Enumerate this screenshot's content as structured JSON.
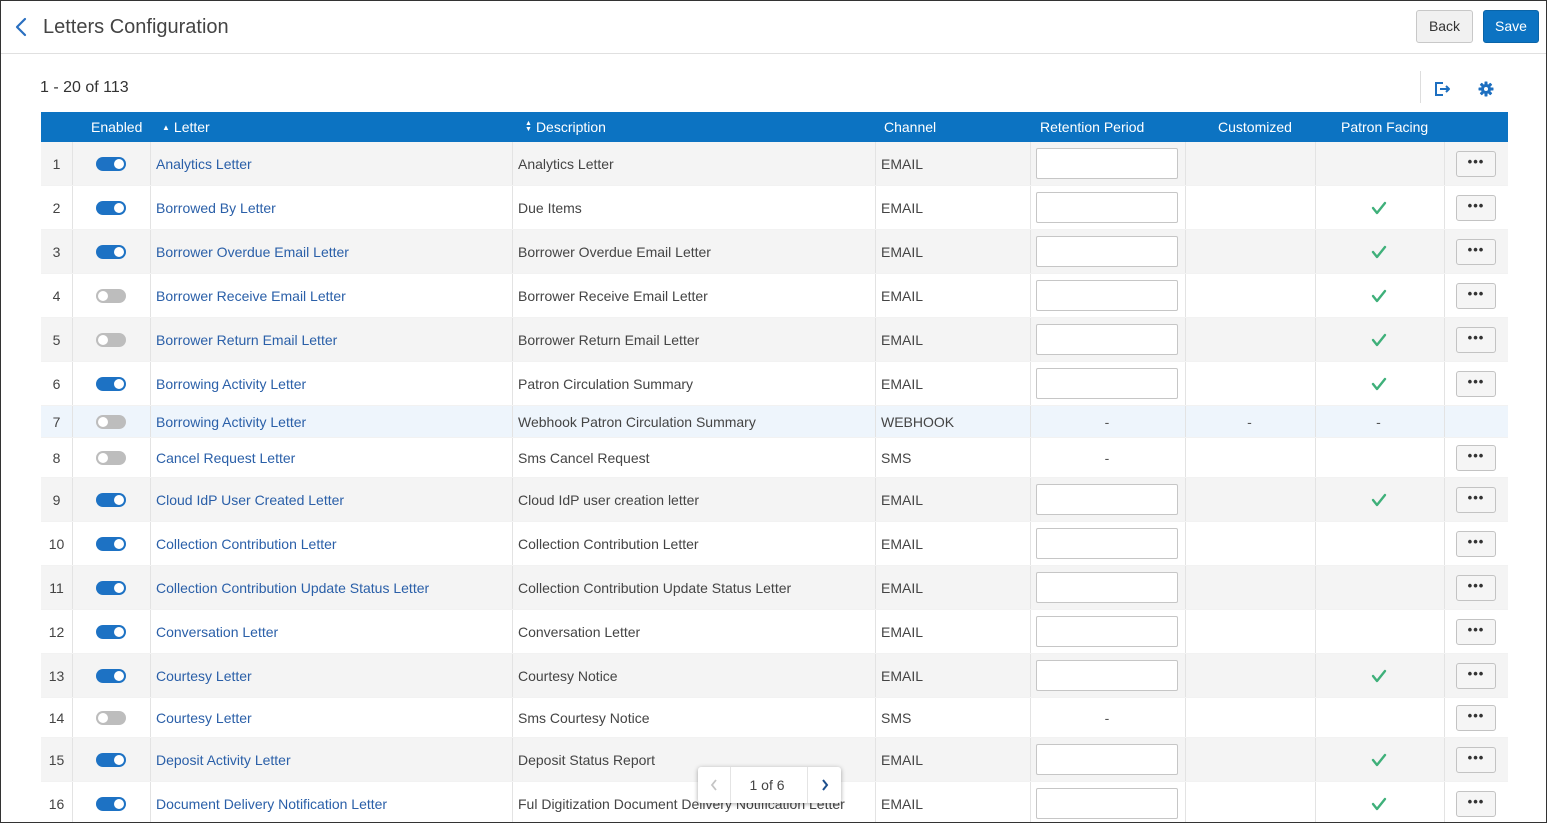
{
  "header": {
    "title": "Letters Configuration",
    "back_label": "Back",
    "save_label": "Save"
  },
  "count_label": "1 - 20 of 113",
  "toolbar": {
    "export_icon": "export-icon",
    "settings_icon": "gear-icon"
  },
  "columns": {
    "enabled": "Enabled",
    "letter": "Letter",
    "description": "Description",
    "channel": "Channel",
    "retention": "Retention Period",
    "customized": "Customized",
    "patron_facing": "Patron Facing"
  },
  "sort": {
    "letter": "ascending",
    "description": "unsorted"
  },
  "rows": [
    {
      "num": "1",
      "enabled": true,
      "letter": "Analytics Letter",
      "description": "Analytics Letter",
      "channel": "EMAIL",
      "retention": "input",
      "customized": "",
      "patron": false,
      "more": true
    },
    {
      "num": "2",
      "enabled": true,
      "letter": "Borrowed By Letter",
      "description": "Due Items",
      "channel": "EMAIL",
      "retention": "input",
      "customized": "",
      "patron": true,
      "more": true
    },
    {
      "num": "3",
      "enabled": true,
      "letter": "Borrower Overdue Email Letter",
      "description": "Borrower Overdue Email Letter",
      "channel": "EMAIL",
      "retention": "input",
      "customized": "",
      "patron": true,
      "more": true
    },
    {
      "num": "4",
      "enabled": false,
      "letter": "Borrower Receive Email Letter",
      "description": "Borrower Receive Email Letter",
      "channel": "EMAIL",
      "retention": "input",
      "customized": "",
      "patron": true,
      "more": true
    },
    {
      "num": "5",
      "enabled": false,
      "letter": "Borrower Return Email Letter",
      "description": "Borrower Return Email Letter",
      "channel": "EMAIL",
      "retention": "input",
      "customized": "",
      "patron": true,
      "more": true
    },
    {
      "num": "6",
      "enabled": true,
      "letter": "Borrowing Activity Letter",
      "description": "Patron Circulation Summary",
      "channel": "EMAIL",
      "retention": "input",
      "customized": "",
      "patron": true,
      "more": true
    },
    {
      "num": "7",
      "enabled": false,
      "letter": "Borrowing Activity Letter",
      "description": "Webhook Patron Circulation Summary",
      "channel": "WEBHOOK",
      "retention": "-",
      "customized": "-",
      "patron": "-",
      "more": false,
      "highlight": true
    },
    {
      "num": "8",
      "enabled": false,
      "letter": "Cancel Request Letter",
      "description": "Sms Cancel Request",
      "channel": "SMS",
      "retention": "-",
      "customized": "",
      "patron": false,
      "more": true
    },
    {
      "num": "9",
      "enabled": true,
      "letter": "Cloud IdP User Created Letter",
      "description": "Cloud IdP user creation letter",
      "channel": "EMAIL",
      "retention": "input",
      "customized": "",
      "patron": true,
      "more": true
    },
    {
      "num": "10",
      "enabled": true,
      "letter": "Collection Contribution Letter",
      "description": "Collection Contribution Letter",
      "channel": "EMAIL",
      "retention": "input",
      "customized": "",
      "patron": false,
      "more": true
    },
    {
      "num": "11",
      "enabled": true,
      "letter": "Collection Contribution Update Status Letter",
      "description": "Collection Contribution Update Status Letter",
      "channel": "EMAIL",
      "retention": "input",
      "customized": "",
      "patron": false,
      "more": true
    },
    {
      "num": "12",
      "enabled": true,
      "letter": "Conversation Letter",
      "description": "Conversation Letter",
      "channel": "EMAIL",
      "retention": "input",
      "customized": "",
      "patron": false,
      "more": true
    },
    {
      "num": "13",
      "enabled": true,
      "letter": "Courtesy Letter",
      "description": "Courtesy Notice",
      "channel": "EMAIL",
      "retention": "input",
      "customized": "",
      "patron": true,
      "more": true
    },
    {
      "num": "14",
      "enabled": false,
      "letter": "Courtesy Letter",
      "description": "Sms Courtesy Notice",
      "channel": "SMS",
      "retention": "-",
      "customized": "",
      "patron": false,
      "more": true
    },
    {
      "num": "15",
      "enabled": true,
      "letter": "Deposit Activity Letter",
      "description": "Deposit Status Report",
      "channel": "EMAIL",
      "retention": "input",
      "customized": "",
      "patron": true,
      "more": true
    },
    {
      "num": "16",
      "enabled": true,
      "letter": "Document Delivery Notification Letter",
      "description": "Ful Digitization Document Delivery Notification Letter",
      "channel": "EMAIL",
      "retention": "input",
      "customized": "",
      "patron": true,
      "more": true
    }
  ],
  "pagination": {
    "label": "1 of 6"
  },
  "colors": {
    "accent": "#0c73c2",
    "link": "#2a5fa8",
    "check": "#3fb07a",
    "toggle_on": "#1d72c4",
    "toggle_off": "#bdbdbd"
  }
}
